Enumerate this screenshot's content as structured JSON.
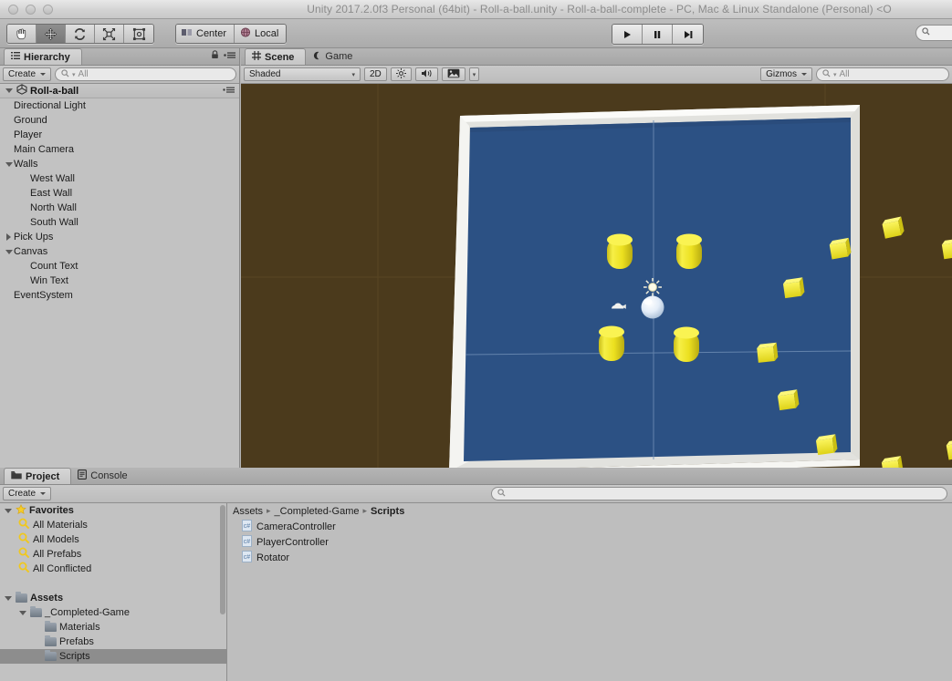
{
  "window": {
    "title": "Unity 2017.2.0f3 Personal (64bit) - Roll-a-ball.unity - Roll-a-ball-complete - PC, Mac & Linux Standalone (Personal) <O"
  },
  "toolbar": {
    "tools": [
      {
        "name": "hand-tool",
        "selected": false
      },
      {
        "name": "move-tool",
        "selected": true
      },
      {
        "name": "rotate-tool",
        "selected": false
      },
      {
        "name": "scale-tool",
        "selected": false
      },
      {
        "name": "rect-tool",
        "selected": false
      }
    ],
    "pivot_label": "Center",
    "space_label": "Local",
    "play_label": "Play",
    "pause_label": "Pause",
    "step_label": "Step"
  },
  "hierarchy": {
    "tab_label": "Hierarchy",
    "create_label": "Create",
    "search_placeholder": "All",
    "scene_name": "Roll-a-ball",
    "items": [
      {
        "label": "Directional Light",
        "depth": 1,
        "toggle": "none"
      },
      {
        "label": "Ground",
        "depth": 1,
        "toggle": "none"
      },
      {
        "label": "Player",
        "depth": 1,
        "toggle": "none"
      },
      {
        "label": "Main Camera",
        "depth": 1,
        "toggle": "none"
      },
      {
        "label": "Walls",
        "depth": 1,
        "toggle": "down"
      },
      {
        "label": "West Wall",
        "depth": 2,
        "toggle": "none"
      },
      {
        "label": "East Wall",
        "depth": 2,
        "toggle": "none"
      },
      {
        "label": "North Wall",
        "depth": 2,
        "toggle": "none"
      },
      {
        "label": "South Wall",
        "depth": 2,
        "toggle": "none"
      },
      {
        "label": "Pick Ups",
        "depth": 1,
        "toggle": "right"
      },
      {
        "label": "Canvas",
        "depth": 1,
        "toggle": "down"
      },
      {
        "label": "Count Text",
        "depth": 2,
        "toggle": "none"
      },
      {
        "label": "Win Text",
        "depth": 2,
        "toggle": "none"
      },
      {
        "label": "EventSystem",
        "depth": 1,
        "toggle": "none"
      }
    ]
  },
  "scene": {
    "tab_scene": "Scene",
    "tab_game": "Game",
    "draw_mode": "Shaded",
    "two_d_label": "2D",
    "gizmos_label": "Gizmos",
    "search_placeholder": "All",
    "colors": {
      "background": "#4b3a1c",
      "ground": "#2c5184",
      "wall": "#f2f2f0",
      "pickup": "#f2e82c",
      "player": "#e8f0fb"
    }
  },
  "project": {
    "tab_project": "Project",
    "tab_console": "Console",
    "create_label": "Create",
    "search_placeholder": "",
    "favorites_label": "Favorites",
    "favorites": [
      {
        "label": "All Materials"
      },
      {
        "label": "All Models"
      },
      {
        "label": "All Prefabs"
      },
      {
        "label": "All Conflicted"
      }
    ],
    "assets_label": "Assets",
    "tree": [
      {
        "label": "_Completed-Game",
        "depth": 1,
        "toggle": "down",
        "selected": false
      },
      {
        "label": "Materials",
        "depth": 2,
        "toggle": "none",
        "selected": false
      },
      {
        "label": "Prefabs",
        "depth": 2,
        "toggle": "none",
        "selected": false
      },
      {
        "label": "Scripts",
        "depth": 2,
        "toggle": "none",
        "selected": true
      }
    ],
    "breadcrumb": [
      "Assets",
      "_Completed-Game",
      "Scripts"
    ],
    "assets": [
      {
        "label": "CameraController",
        "type": "csharp-script"
      },
      {
        "label": "PlayerController",
        "type": "csharp-script"
      },
      {
        "label": "Rotator",
        "type": "csharp-script"
      }
    ]
  }
}
